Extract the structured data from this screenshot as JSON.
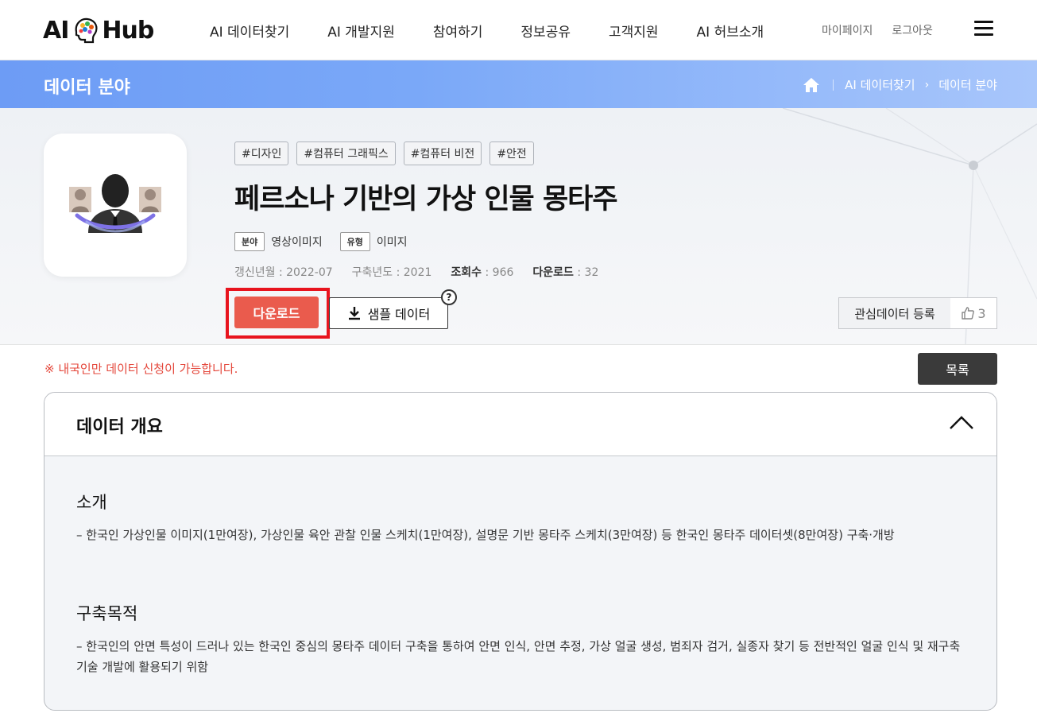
{
  "header": {
    "logo_left": "AI",
    "logo_right": "Hub",
    "nav": [
      "AI 데이터찾기",
      "AI 개발지원",
      "참여하기",
      "정보공유",
      "고객지원",
      "AI 허브소개"
    ],
    "util": [
      "마이페이지",
      "로그아웃"
    ]
  },
  "title_bar": {
    "title": "데이터 분야",
    "breadcrumb": [
      "AI 데이터찾기",
      "데이터 분야"
    ]
  },
  "dataset": {
    "tags": [
      "#디자인",
      "#컴퓨터 그래픽스",
      "#컴퓨터 비전",
      "#안전"
    ],
    "title": "페르소나 기반의 가상 인물 몽타주",
    "field_badge": "분야",
    "field_value": "영상이미지",
    "type_badge": "유형",
    "type_value": "이미지",
    "updated": "갱신년월 : 2022-07",
    "built_year": "구축년도 : 2021",
    "views_label": "조회수",
    "views_value": " : 966",
    "downloads_label": "다운로드",
    "downloads_value": " : 32"
  },
  "actions": {
    "download": "다운로드",
    "sample": "샘플 데이터",
    "help": "?",
    "favorite": "관심데이터 등록",
    "likes": "3"
  },
  "notice": "※ 내국인만 데이터 신청이 가능합니다.",
  "list_button": "목록",
  "overview": {
    "title": "데이터 개요",
    "sections": [
      {
        "heading": "소개",
        "body": "–  한국인 가상인물 이미지(1만여장), 가상인물 육안 관찰 인물 스케치(1만여장), 설명문 기반 몽타주 스케치(3만여장) 등 한국인 몽타주 데이터셋(8만여장) 구축·개방"
      },
      {
        "heading": "구축목적",
        "body": "– 한국인의 안면 특성이 드러나 있는 한국인 중심의 몽타주 데이터 구축을 통하여 안면 인식, 안면 추정, 가상 얼굴 생성, 범죄자 검거, 실종자 찾기 등 전반적인 얼굴 인식 및 재구축 기술 개발에 활용되기 위함"
      }
    ]
  },
  "colors": {
    "accent_red": "#ea5b4d",
    "highlight_red": "#e8141e",
    "title_bar_blue": "#6d9cf5",
    "dark_button": "#3a3a3a"
  }
}
